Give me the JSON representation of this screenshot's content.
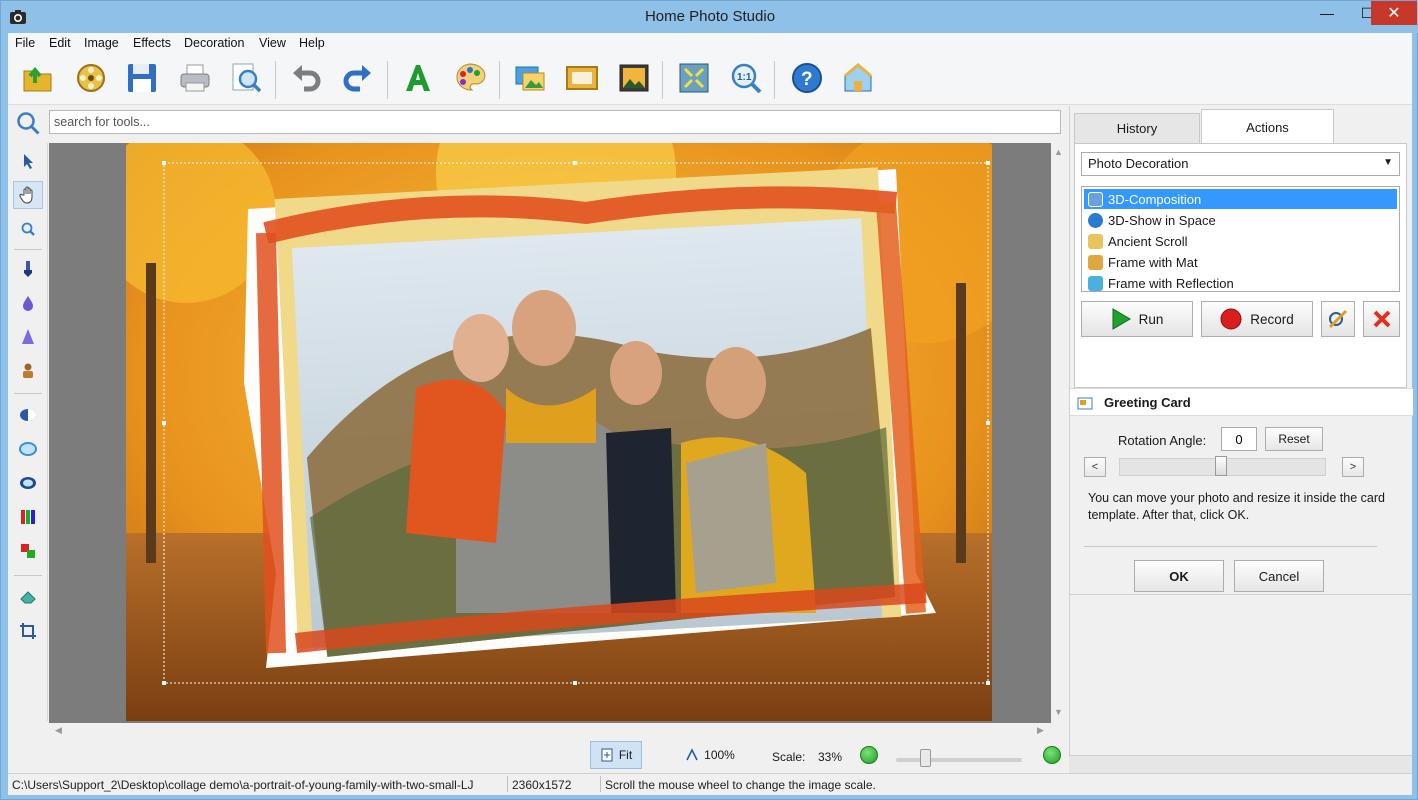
{
  "window": {
    "title": "Home Photo Studio",
    "min_glyph": "—",
    "max_glyph": "☐",
    "close_glyph": "✕"
  },
  "menu": {
    "items": [
      "File",
      "Edit",
      "Image",
      "Effects",
      "Decoration",
      "View",
      "Help"
    ]
  },
  "toolbar": {
    "buttons": [
      {
        "icon": "open-folder-icon"
      },
      {
        "icon": "film-reel-icon"
      },
      {
        "icon": "save-floppy-icon"
      },
      {
        "icon": "print-icon"
      },
      {
        "icon": "print-preview-icon"
      },
      {
        "icon": "undo-icon"
      },
      {
        "icon": "redo-icon"
      },
      {
        "icon": "text-a-icon"
      },
      {
        "icon": "palette-icon"
      },
      {
        "icon": "image-adjust-icon"
      },
      {
        "icon": "frame-icon"
      },
      {
        "icon": "picture-icon"
      },
      {
        "icon": "fit-to-window-icon"
      },
      {
        "icon": "zoom-actual-size-icon"
      },
      {
        "icon": "help-icon"
      },
      {
        "icon": "home-icon"
      }
    ]
  },
  "search": {
    "placeholder": "search for tools..."
  },
  "tools": {
    "items": [
      "arrow-pointer-icon",
      "hand-pan-icon",
      "zoom-magnifier-icon",
      "brush-icon",
      "drop-icon",
      "cone-icon",
      "stamp-icon",
      "contrast-icon",
      "lens-icon",
      "eye-icon",
      "color-bars-icon",
      "color-swap-icon",
      "eraser-icon",
      "crop-icon"
    ]
  },
  "panel": {
    "tabs": {
      "history": "History",
      "actions": "Actions"
    },
    "category": "Photo Decoration",
    "actions": [
      {
        "label": "3D-Composition",
        "selected": true,
        "color": "#6aa0e0"
      },
      {
        "label": "3D-Show in Space",
        "selected": false,
        "color": "#2a7bd0"
      },
      {
        "label": "Ancient Scroll",
        "selected": false,
        "color": "#e8c45a"
      },
      {
        "label": "Frame with Mat",
        "selected": false,
        "color": "#e0a640"
      },
      {
        "label": "Frame with Reflection",
        "selected": false,
        "color": "#4ab0e0"
      }
    ],
    "run_label": "Run",
    "record_label": "Record"
  },
  "greeting_card": {
    "title": "Greeting Card",
    "rotation_label": "Rotation Angle:",
    "rotation_value": "0",
    "reset_label": "Reset",
    "instructions": "You can move your photo and resize it inside the card template. After that, click OK.",
    "ok_label": "OK",
    "cancel_label": "Cancel"
  },
  "zoom": {
    "fit_label": "Fit",
    "actual_label": "100%",
    "scale_label": "Scale:",
    "scale_value": "33%"
  },
  "status": {
    "path": "C:\\Users\\Support_2\\Desktop\\collage demo\\a-portrait-of-young-family-with-two-small-LJ",
    "dimensions": "2360x1572",
    "hint": "Scroll the mouse wheel to change the image scale."
  },
  "colors": {
    "title_bar": "#8fc1e8",
    "close_button": "#c7372a",
    "selection": "#3399ff",
    "canvas_bg": "#7c7c7c"
  }
}
